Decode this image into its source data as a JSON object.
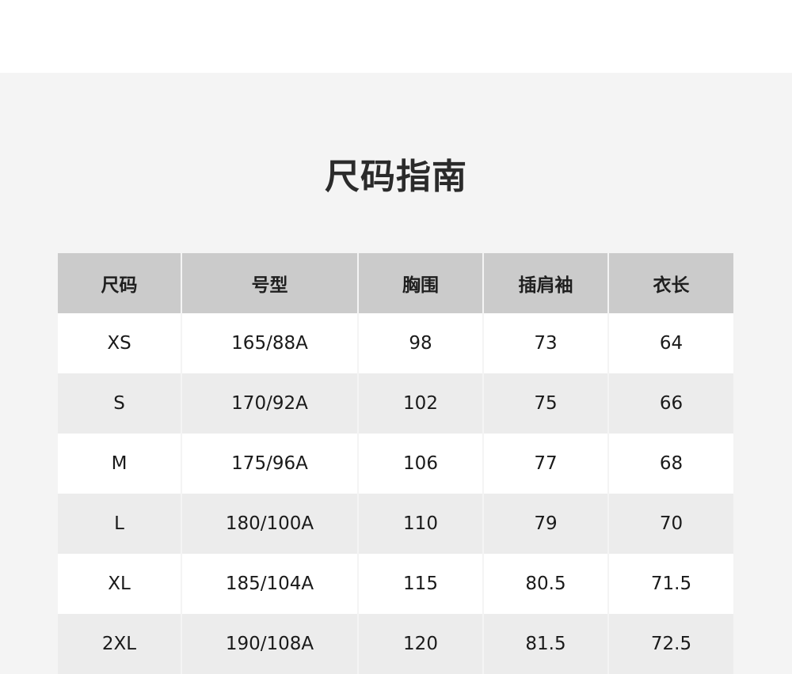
{
  "title": "尺码指南",
  "table": {
    "headers": [
      "尺码",
      "号型",
      "胸围",
      "插肩袖",
      "衣长"
    ],
    "rows": [
      [
        "XS",
        "165/88A",
        "98",
        "73",
        "64"
      ],
      [
        "S",
        "170/92A",
        "102",
        "75",
        "66"
      ],
      [
        "M",
        "175/96A",
        "106",
        "77",
        "68"
      ],
      [
        "L",
        "180/100A",
        "110",
        "79",
        "70"
      ],
      [
        "XL",
        "185/104A",
        "115",
        "80.5",
        "71.5"
      ],
      [
        "2XL",
        "190/108A",
        "120",
        "81.5",
        "72.5"
      ]
    ]
  },
  "colors": {
    "background": "#f4f4f4",
    "header_bg": "#cbcbcb",
    "row_alt_bg": "#ececec",
    "row_bg": "#ffffff"
  }
}
